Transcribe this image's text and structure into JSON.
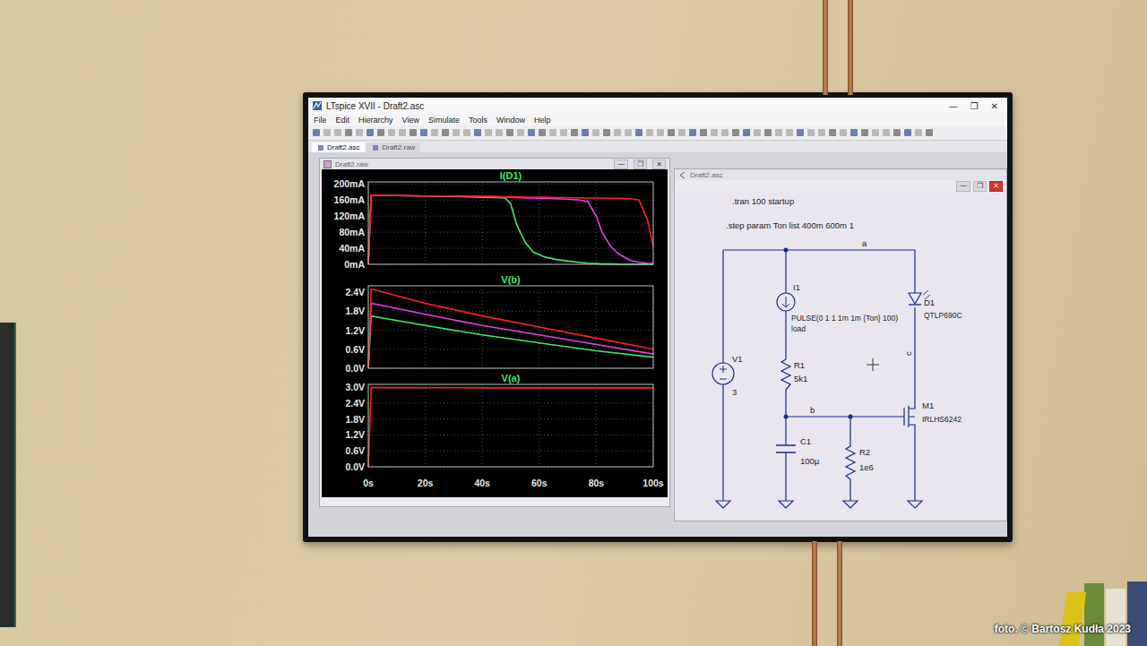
{
  "window": {
    "title": "LTspice XVII - Draft2.asc",
    "controls": [
      "—",
      "❐",
      "✕"
    ]
  },
  "menu": [
    "File",
    "Edit",
    "Hierarchy",
    "View",
    "Simulate",
    "Tools",
    "Window",
    "Help"
  ],
  "tabs": [
    {
      "label": "Draft2.asc",
      "selected": true
    },
    {
      "label": "Draft2.raw",
      "selected": false
    }
  ],
  "waveform_window": {
    "title": "Draft2.raw",
    "controls": [
      "—",
      "❐",
      "✕"
    ],
    "plot": {
      "x_ticks": [
        "0s",
        "20s",
        "40s",
        "60s",
        "80s",
        "100s"
      ],
      "x_max": 100,
      "panes": [
        {
          "title": "I(D1)",
          "y_ticks": [
            "200mA",
            "160mA",
            "120mA",
            "80mA",
            "40mA",
            "0mA"
          ],
          "y_max": 205,
          "t": [
            0,
            1,
            10,
            20,
            30,
            40,
            45,
            48,
            50,
            52,
            55,
            58,
            62,
            66,
            70,
            74,
            77,
            80,
            82,
            85,
            88,
            92,
            95,
            98,
            100
          ],
          "series": [
            {
              "color": "#3ee86b",
              "values": [
                0,
                172,
                171,
                170,
                169,
                167,
                166,
                165,
                150,
                100,
                55,
                30,
                18,
                12,
                8,
                5,
                3,
                2,
                1,
                1,
                0,
                0,
                0,
                0,
                0
              ]
            },
            {
              "color": "#e83ee8",
              "values": [
                0,
                172,
                171,
                170,
                170,
                169,
                168,
                167,
                167,
                166,
                165,
                165,
                164,
                163,
                162,
                160,
                156,
                120,
                80,
                45,
                25,
                10,
                5,
                3,
                2
              ]
            },
            {
              "color": "#ff2020",
              "values": [
                0,
                172,
                171,
                170,
                170,
                169,
                169,
                168,
                168,
                168,
                167,
                167,
                167,
                166,
                166,
                165,
                165,
                165,
                165,
                164,
                164,
                163,
                160,
                110,
                45
              ]
            }
          ]
        },
        {
          "title": "V(b)",
          "y_ticks": [
            "2.4V",
            "1.8V",
            "1.2V",
            "0.6V",
            "0.0V"
          ],
          "y_max": 2.6,
          "t": [
            0,
            1,
            20,
            40,
            60,
            80,
            100
          ],
          "series": [
            {
              "color": "#3ee86b",
              "values": [
                0,
                1.65,
                1.35,
                1.05,
                0.8,
                0.55,
                0.35
              ]
            },
            {
              "color": "#e83ee8",
              "values": [
                0,
                2.05,
                1.7,
                1.35,
                1.05,
                0.75,
                0.45
              ]
            },
            {
              "color": "#ff2020",
              "values": [
                0,
                2.5,
                2.05,
                1.65,
                1.3,
                0.95,
                0.6
              ]
            }
          ]
        },
        {
          "title": "V(a)",
          "y_ticks": [
            "3.0V",
            "2.4V",
            "1.8V",
            "1.2V",
            "0.6V",
            "0.0V"
          ],
          "y_max": 3.1,
          "t": [
            0,
            1,
            50,
            100
          ],
          "series": [
            {
              "color": "#ff2020",
              "values": [
                0,
                2.98,
                2.97,
                2.97
              ]
            }
          ]
        }
      ]
    }
  },
  "schematic_window": {
    "title": "Draft2.asc",
    "controls": [
      "—",
      "❐",
      "✕"
    ],
    "directives": [
      ".tran 100 startup",
      ".step param Ton list 400m 600m 1"
    ],
    "nets": [
      "a",
      "b",
      "c"
    ],
    "components": [
      {
        "ref": "V1",
        "values": [
          "3"
        ]
      },
      {
        "ref": "I1",
        "values": [
          "PULSE(0 1 1 1m 1m {Ton} 100)",
          "load"
        ]
      },
      {
        "ref": "R1",
        "values": [
          "5k1"
        ]
      },
      {
        "ref": "C1",
        "values": [
          "100µ"
        ]
      },
      {
        "ref": "R2",
        "values": [
          "1e6"
        ]
      },
      {
        "ref": "D1",
        "values": [
          "QTLP690C"
        ]
      },
      {
        "ref": "M1",
        "values": [
          "IRLHS6242"
        ]
      }
    ]
  },
  "watermark": "foto. © Bartosz Kudła 2023"
}
